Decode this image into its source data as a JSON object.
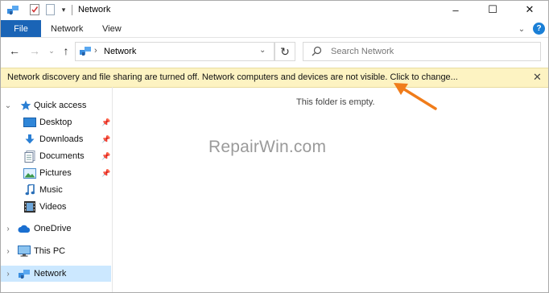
{
  "window": {
    "title": "Network"
  },
  "ribbon": {
    "tabs": [
      {
        "label": "File"
      },
      {
        "label": "Network"
      },
      {
        "label": "View"
      }
    ]
  },
  "address": {
    "location": "Network",
    "separator": "›"
  },
  "search": {
    "placeholder": "Search Network"
  },
  "infobar": {
    "message": "Network discovery and file sharing are turned off. Network computers and devices are not visible. Click to change..."
  },
  "nav": {
    "items": [
      {
        "label": "Quick access",
        "icon": "star-icon"
      },
      {
        "label": "Desktop",
        "icon": "desktop-folder-icon",
        "pinned": true
      },
      {
        "label": "Downloads",
        "icon": "download-icon",
        "pinned": true
      },
      {
        "label": "Documents",
        "icon": "documents-icon",
        "pinned": true
      },
      {
        "label": "Pictures",
        "icon": "pictures-icon",
        "pinned": true
      },
      {
        "label": "Music",
        "icon": "music-icon"
      },
      {
        "label": "Videos",
        "icon": "videos-icon"
      },
      {
        "label": "OneDrive",
        "icon": "cloud-icon"
      },
      {
        "label": "This PC",
        "icon": "computer-icon"
      },
      {
        "label": "Network",
        "icon": "network-icon",
        "selected": true
      }
    ]
  },
  "main": {
    "empty_text": "This folder is empty."
  },
  "watermark": "RepairWin.com",
  "colors": {
    "accent": "#1a64b6",
    "infobar_bg": "#fdf3c2",
    "selection": "#cce8ff",
    "arrow": "#f07c1a"
  }
}
